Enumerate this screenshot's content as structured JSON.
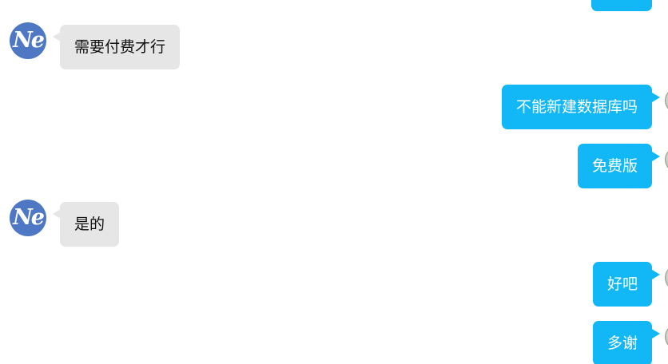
{
  "contact": {
    "avatar_text": "Ne",
    "avatar_color": "#4e78c4"
  },
  "colors": {
    "incoming_bubble": "#e6e6e6",
    "outgoing_bubble": "#12b7f5"
  },
  "messages": [
    {
      "sender": "contact",
      "text": "需要付费才行"
    },
    {
      "sender": "self",
      "text": "不能新建数据库吗"
    },
    {
      "sender": "self",
      "text": "免费版"
    },
    {
      "sender": "contact",
      "text": "是的"
    },
    {
      "sender": "self",
      "text": "好吧"
    },
    {
      "sender": "self",
      "text": "多谢"
    }
  ]
}
